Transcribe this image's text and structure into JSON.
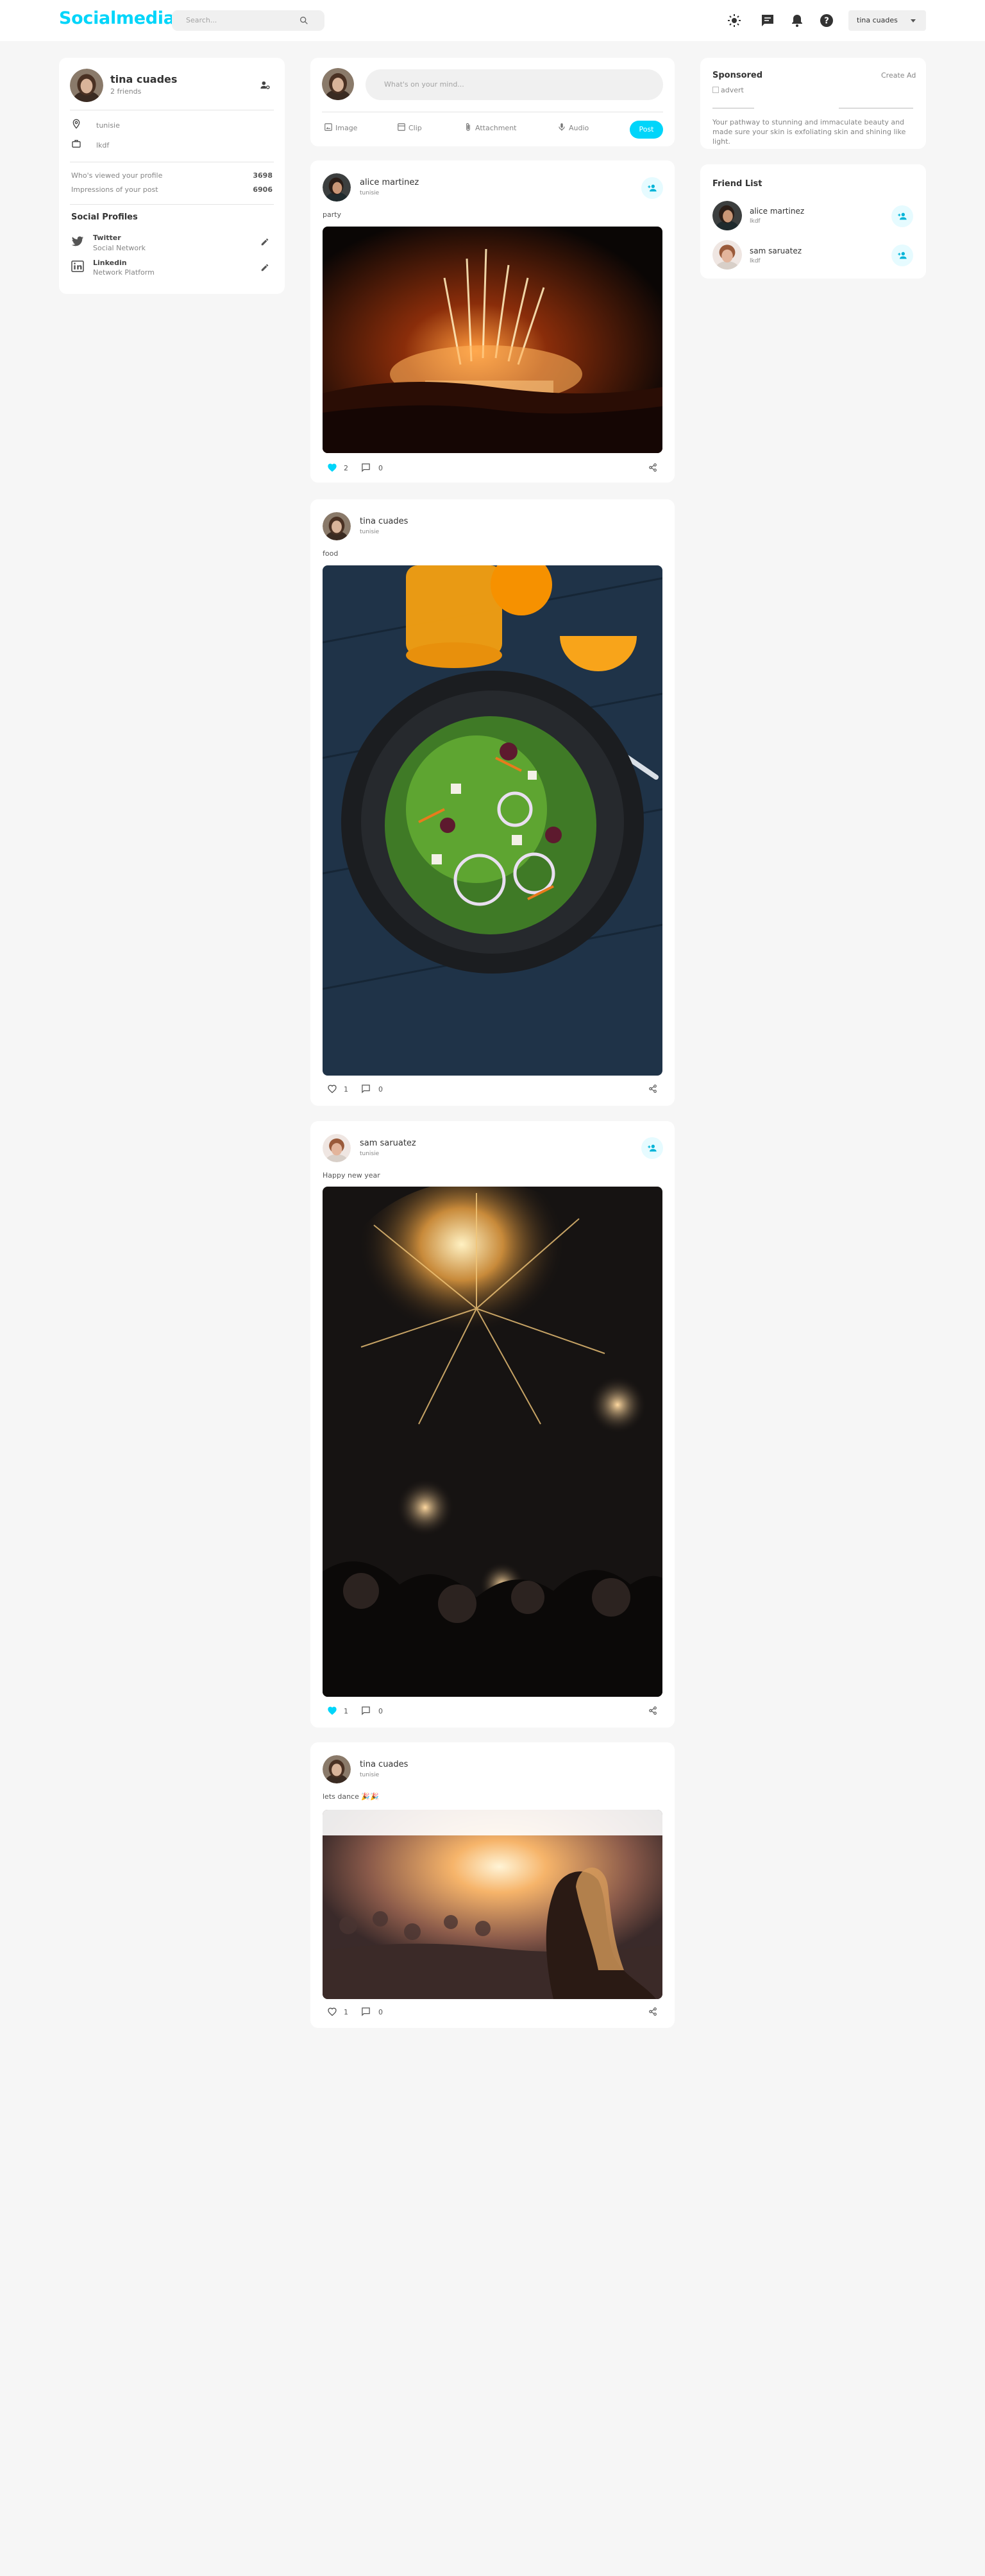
{
  "header": {
    "logo": "Socialmedia",
    "search_placeholder": "Search...",
    "user_name": "tina cuades",
    "icons": [
      "light-mode-icon",
      "message-icon",
      "notification-icon",
      "help-icon",
      "search-icon"
    ]
  },
  "profile": {
    "name": "tina cuades",
    "friends": "2 friends",
    "location": "tunisie",
    "occupation": "lkdf",
    "viewed_label": "Who's viewed your profile",
    "viewed_value": "3698",
    "impressions_label": "Impressions of your post",
    "impressions_value": "6906",
    "social_title": "Social Profiles",
    "socials": [
      {
        "name": "Twitter",
        "type": "Social Network"
      },
      {
        "name": "Linkedin",
        "type": "Network Platform"
      }
    ]
  },
  "composer": {
    "placeholder": "What's on your mind...",
    "tools": [
      "Image",
      "Clip",
      "Attachment",
      "Audio"
    ],
    "post_label": "Post"
  },
  "posts": [
    {
      "author": "alice martinez",
      "location": "tunisie",
      "description": "party",
      "likes": "2",
      "comments": "0",
      "liked": true,
      "image": "concert-photo"
    },
    {
      "author": "tina cuades",
      "location": "tunisie",
      "description": "food",
      "likes": "1",
      "comments": "0",
      "liked": false,
      "image": "salad-photo"
    },
    {
      "author": "sam saruatez",
      "location": "tunisie",
      "description": "Happy new year",
      "likes": "1",
      "comments": "0",
      "liked": true,
      "image": "fireworks-photo"
    },
    {
      "author": "tina cuades",
      "location": "tunisie",
      "description": "lets dance 🎉🎉",
      "likes": "1",
      "comments": "0",
      "liked": false,
      "image": "festival-photo"
    }
  ],
  "sponsored": {
    "title": "Sponsored",
    "create_ad": "Create Ad",
    "image_alt": "advert",
    "text": "Your pathway to stunning and immaculate beauty and made sure your skin is exfoliating skin and shining like light."
  },
  "friend_list": {
    "title": "Friend List",
    "friends": [
      {
        "name": "alice martinez",
        "occupation": "lkdf"
      },
      {
        "name": "sam saruatez",
        "occupation": "lkdf"
      }
    ]
  },
  "colors": {
    "accent": "#00d5fa",
    "background": "#f6f6f6",
    "card": "#ffffff"
  }
}
